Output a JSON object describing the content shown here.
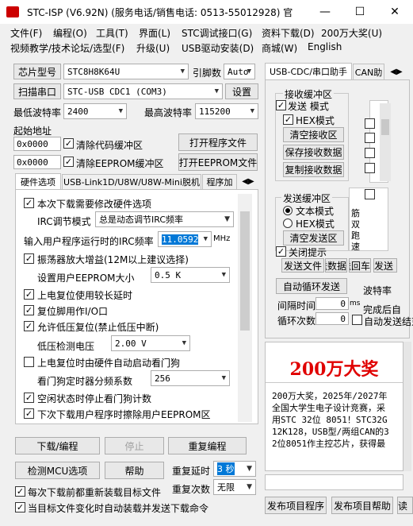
{
  "window": {
    "title": "STC-ISP (V6.92N) (服务电话/销售电话: 0513-55012928) 官",
    "min": "—",
    "max": "☐",
    "close": "✕"
  },
  "menu1": [
    "文件(F)",
    "编程(O)",
    "工具(T)",
    "界面(L)",
    "STC调试接口(G)",
    "资料下载(D)",
    "200万大奖(U)"
  ],
  "menu2": [
    "视频教学/技术论坛/选型(F)",
    "升级(U)",
    "USB驱动安装(D)",
    "商城(W)",
    "English"
  ],
  "chip": {
    "button": "芯片型号",
    "value": "STC8H8K64U",
    "pins_label": "引脚数",
    "pins_value": "Auto"
  },
  "port": {
    "button": "扫描串口",
    "value": "STC-USB CDC1 (COM3)",
    "settings": "设置"
  },
  "baud": {
    "min_label": "最低波特率",
    "min_value": "2400",
    "max_label": "最高波特率",
    "max_value": "115200"
  },
  "start_addr": {
    "label": "起始地址",
    "addr1": "0x0000",
    "clear_code": "清除代码缓冲区",
    "open_prog": "打开程序文件",
    "addr2": "0x0000",
    "clear_eeprom": "清除EEPROM缓冲区",
    "open_eeprom": "打开EEPROM文件"
  },
  "left_tabs": [
    "硬件选项",
    "USB-Link1D/U8W/U8W-Mini脱机",
    "程序加"
  ],
  "hw": {
    "reconfig": "本次下载需要修改硬件选项",
    "irc_label": "IRC调节模式",
    "irc_value": "总是动态调节IRC频率",
    "freq_label": "输入用户程序运行时的IRC频率",
    "freq_value": "11.0592",
    "freq_unit": "MHz",
    "amp": "振荡器放大增益(12M以上建议选择)",
    "eeprom_label": "设置用户EEPROM大小",
    "eeprom_value": "0.5 K",
    "long_reset": "上电复位使用较长延时",
    "reset_io": "复位脚用作I/O口",
    "lvr": "允许低压复位(禁止低压中断)",
    "lvd_label": "低压检测电压",
    "lvd_value": "2.00 V",
    "wdt": "上电复位时由硬件自动启动看门狗",
    "wdt_div_label": "看门狗定时器分频系数",
    "wdt_div_value": "256",
    "idle_wdt": "空闲状态时停止看门狗计数",
    "erase_eeprom": "下次下载用户程序时擦除用户EEPROM区"
  },
  "actions": {
    "download": "下载/编程",
    "stop": "停止",
    "reprogram": "重复编程",
    "detect": "检测MCU选项",
    "help": "帮助",
    "delay_label": "重复延时",
    "delay_value": "3 秒",
    "count_label": "重复次数",
    "count_value": "无限"
  },
  "bottom_checks": {
    "reload": "每次下载前都重新装载目标文件",
    "auto_send": "当目标文件变化时自动装载并发送下载命令"
  },
  "right_tabs": [
    "USB-CDC/串口助手",
    "CAN助"
  ],
  "recv": {
    "title": "接收缓冲区",
    "text_mode": "发送  模式",
    "hex_mode": "HEX模式",
    "clear": "清空接收区",
    "save": "保存接收数据",
    "copy": "复制接收数据"
  },
  "send": {
    "title": "发送缓冲区",
    "text_mode": "文本模式",
    "hex_mode": "HEX模式",
    "clear": "清空发送区",
    "close_tip": "关闭提示",
    "send_file": "发送文件",
    "send_data": "发送数据",
    "send_return": "发送回车",
    "send_more": "发送",
    "auto_loop": "自动循环发送",
    "baud": "波特率",
    "interval_label": "间隔时间",
    "interval_value": "0",
    "interval_unit": "ms",
    "loop_label": "循环次数",
    "loop_value": "0",
    "done_tip": "完成后自",
    "auto_send_end": "自动发送结束"
  },
  "preview_lines": [
    "筋",
    "双",
    "跑",
    "速"
  ],
  "promo": {
    "banner": "200万大奖",
    "banner_color": "#e00000",
    "text": "200万大奖，2025年/2027年全国大学生电子设计竞赛，采用STC 32位 8051！STC32G12K128，USB型/两组CAN的32位8051作主控芯片，获得最"
  },
  "footer": {
    "publish_prog": "发布项目程序",
    "publish_help": "发布项目帮助",
    "more": "读"
  }
}
